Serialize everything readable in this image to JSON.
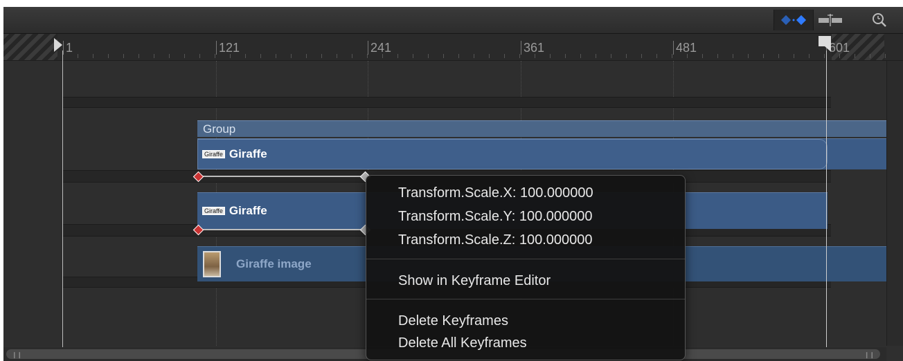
{
  "toolbar": {
    "keyframe_toggle_icon": "show-keyframes-icon",
    "snap_icon": "snapping-icon",
    "zoom_icon": "zoom-icon"
  },
  "ruler": {
    "ticks": [
      "1",
      "121",
      "241",
      "361",
      "481",
      "601"
    ]
  },
  "tracks": {
    "group_label": "Group",
    "layer1_thumb": "Giraffe",
    "layer1_label": "Giraffe",
    "layer2_thumb": "Giraffe",
    "layer2_label": "Giraffe",
    "image_label": "Giraffe image"
  },
  "context_menu": {
    "items": [
      "Transform.Scale.X: 100.000000",
      "Transform.Scale.Y: 100.000000",
      "Transform.Scale.Z: 100.000000",
      "Show in Keyframe Editor",
      "Delete Keyframes",
      "Delete All Keyframes"
    ]
  },
  "colors": {
    "accent": "#2f7bff",
    "clip": "#3b5b86",
    "keyframe": "#c93232"
  }
}
